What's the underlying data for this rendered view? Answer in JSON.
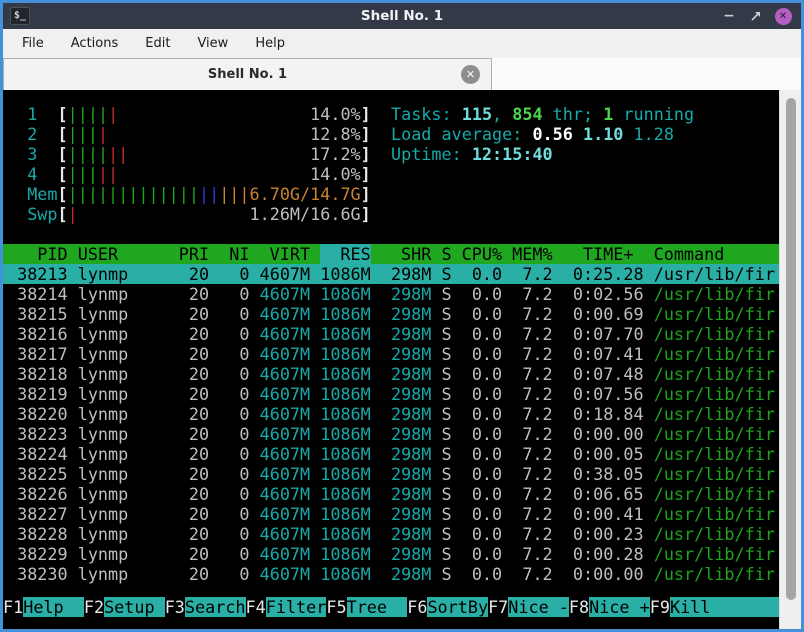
{
  "window": {
    "title": "Shell No. 1",
    "app_icon_glyph": "$_"
  },
  "titlebar_controls": {
    "minimize_glyph": "−",
    "close_glyph": "✕"
  },
  "menu": {
    "items": [
      "File",
      "Actions",
      "Edit",
      "View",
      "Help"
    ]
  },
  "tab": {
    "label": "Shell No. 1",
    "close_glyph": "✕"
  },
  "colors": {
    "frame_blue": "#4490DB",
    "titlebar_bg": "#333947",
    "close_button_purple": "#B55FC5",
    "header_green_bg": "#1FA81F",
    "selection_cyan_bg": "#29AFA5",
    "text_cyan": "#18A9A9",
    "text_bright_cyan": "#70DCDC",
    "text_green": "#1CA51C",
    "text_bright_green": "#4FD44F",
    "text_gray": "#BFBFBF",
    "bar_red": "#BE2D26",
    "bar_blue": "#3434D2",
    "bar_orange": "#C8832F"
  },
  "htop": {
    "meters": [
      {
        "label": "1",
        "bars": [
          {
            "color": "green",
            "text": "||||"
          },
          {
            "color": "red",
            "text": "|"
          }
        ],
        "value": "14.0%",
        "value_color": "gray"
      },
      {
        "label": "2",
        "bars": [
          {
            "color": "green",
            "text": "|||"
          },
          {
            "color": "red",
            "text": "|"
          }
        ],
        "value": "12.8%",
        "value_color": "gray"
      },
      {
        "label": "3",
        "bars": [
          {
            "color": "green",
            "text": "||||"
          },
          {
            "color": "red",
            "text": "||"
          }
        ],
        "value": "17.2%",
        "value_color": "gray"
      },
      {
        "label": "4",
        "bars": [
          {
            "color": "green",
            "text": "|||"
          },
          {
            "color": "red",
            "text": "||"
          }
        ],
        "value": "14.0%",
        "value_color": "gray"
      },
      {
        "label": "Mem",
        "bars": [
          {
            "color": "green",
            "text": "|||||||||||||"
          },
          {
            "color": "blue",
            "text": "||"
          },
          {
            "color": "orange",
            "text": "|||"
          }
        ],
        "value": "6.70G/14.7G",
        "value_color": "orange"
      },
      {
        "label": "Swp",
        "bars": [
          {
            "color": "red",
            "text": "|"
          }
        ],
        "value": "1.26M/16.6G",
        "value_color": "gray"
      }
    ],
    "stats": [
      [
        [
          "Tasks: ",
          "cyan"
        ],
        [
          "115",
          "bcyan"
        ],
        [
          ", ",
          "cyan"
        ],
        [
          "854",
          "bgreen"
        ],
        [
          " thr; ",
          "cyan"
        ],
        [
          "1",
          "bgreen"
        ],
        [
          " running",
          "cyan"
        ]
      ],
      [
        [
          "Load average: ",
          "cyan"
        ],
        [
          "0.56",
          "bwhite"
        ],
        [
          " ",
          "cyan"
        ],
        [
          "1.10",
          "bcyan"
        ],
        [
          " ",
          "cyan"
        ],
        [
          "1.28",
          "cyan"
        ]
      ],
      [
        [
          "Uptime: ",
          "cyan"
        ],
        [
          "12:15:40",
          "bcyan"
        ]
      ]
    ],
    "table": {
      "header_segments": [
        {
          "text": "   PID USER      PRI  NI  VIRT ",
          "selected": false
        },
        {
          "text": "  RES",
          "selected": true
        },
        {
          "text": "   SHR S CPU% MEM%   TIME+  Command",
          "selected": false
        }
      ],
      "selected_pid": "38213",
      "rows": [
        {
          "pid": "38213",
          "user": "lynmp",
          "pri": "20",
          "ni": "0",
          "virt": "4607M",
          "res": "1086M",
          "shr": "298M",
          "s": "S",
          "cpu": "0.0",
          "mem": "7.2",
          "time": "0:25.28",
          "cmd": "/usr/lib/fir"
        },
        {
          "pid": "38214",
          "user": "lynmp",
          "pri": "20",
          "ni": "0",
          "virt": "4607M",
          "res": "1086M",
          "shr": "298M",
          "s": "S",
          "cpu": "0.0",
          "mem": "7.2",
          "time": "0:02.56",
          "cmd": "/usr/lib/fir"
        },
        {
          "pid": "38215",
          "user": "lynmp",
          "pri": "20",
          "ni": "0",
          "virt": "4607M",
          "res": "1086M",
          "shr": "298M",
          "s": "S",
          "cpu": "0.0",
          "mem": "7.2",
          "time": "0:00.69",
          "cmd": "/usr/lib/fir"
        },
        {
          "pid": "38216",
          "user": "lynmp",
          "pri": "20",
          "ni": "0",
          "virt": "4607M",
          "res": "1086M",
          "shr": "298M",
          "s": "S",
          "cpu": "0.0",
          "mem": "7.2",
          "time": "0:07.70",
          "cmd": "/usr/lib/fir"
        },
        {
          "pid": "38217",
          "user": "lynmp",
          "pri": "20",
          "ni": "0",
          "virt": "4607M",
          "res": "1086M",
          "shr": "298M",
          "s": "S",
          "cpu": "0.0",
          "mem": "7.2",
          "time": "0:07.41",
          "cmd": "/usr/lib/fir"
        },
        {
          "pid": "38218",
          "user": "lynmp",
          "pri": "20",
          "ni": "0",
          "virt": "4607M",
          "res": "1086M",
          "shr": "298M",
          "s": "S",
          "cpu": "0.0",
          "mem": "7.2",
          "time": "0:07.48",
          "cmd": "/usr/lib/fir"
        },
        {
          "pid": "38219",
          "user": "lynmp",
          "pri": "20",
          "ni": "0",
          "virt": "4607M",
          "res": "1086M",
          "shr": "298M",
          "s": "S",
          "cpu": "0.0",
          "mem": "7.2",
          "time": "0:07.56",
          "cmd": "/usr/lib/fir"
        },
        {
          "pid": "38220",
          "user": "lynmp",
          "pri": "20",
          "ni": "0",
          "virt": "4607M",
          "res": "1086M",
          "shr": "298M",
          "s": "S",
          "cpu": "0.0",
          "mem": "7.2",
          "time": "0:18.84",
          "cmd": "/usr/lib/fir"
        },
        {
          "pid": "38223",
          "user": "lynmp",
          "pri": "20",
          "ni": "0",
          "virt": "4607M",
          "res": "1086M",
          "shr": "298M",
          "s": "S",
          "cpu": "0.0",
          "mem": "7.2",
          "time": "0:00.00",
          "cmd": "/usr/lib/fir"
        },
        {
          "pid": "38224",
          "user": "lynmp",
          "pri": "20",
          "ni": "0",
          "virt": "4607M",
          "res": "1086M",
          "shr": "298M",
          "s": "S",
          "cpu": "0.0",
          "mem": "7.2",
          "time": "0:00.05",
          "cmd": "/usr/lib/fir"
        },
        {
          "pid": "38225",
          "user": "lynmp",
          "pri": "20",
          "ni": "0",
          "virt": "4607M",
          "res": "1086M",
          "shr": "298M",
          "s": "S",
          "cpu": "0.0",
          "mem": "7.2",
          "time": "0:38.05",
          "cmd": "/usr/lib/fir"
        },
        {
          "pid": "38226",
          "user": "lynmp",
          "pri": "20",
          "ni": "0",
          "virt": "4607M",
          "res": "1086M",
          "shr": "298M",
          "s": "S",
          "cpu": "0.0",
          "mem": "7.2",
          "time": "0:06.65",
          "cmd": "/usr/lib/fir"
        },
        {
          "pid": "38227",
          "user": "lynmp",
          "pri": "20",
          "ni": "0",
          "virt": "4607M",
          "res": "1086M",
          "shr": "298M",
          "s": "S",
          "cpu": "0.0",
          "mem": "7.2",
          "time": "0:00.41",
          "cmd": "/usr/lib/fir"
        },
        {
          "pid": "38228",
          "user": "lynmp",
          "pri": "20",
          "ni": "0",
          "virt": "4607M",
          "res": "1086M",
          "shr": "298M",
          "s": "S",
          "cpu": "0.0",
          "mem": "7.2",
          "time": "0:00.23",
          "cmd": "/usr/lib/fir"
        },
        {
          "pid": "38229",
          "user": "lynmp",
          "pri": "20",
          "ni": "0",
          "virt": "4607M",
          "res": "1086M",
          "shr": "298M",
          "s": "S",
          "cpu": "0.0",
          "mem": "7.2",
          "time": "0:00.28",
          "cmd": "/usr/lib/fir"
        },
        {
          "pid": "38230",
          "user": "lynmp",
          "pri": "20",
          "ni": "0",
          "virt": "4607M",
          "res": "1086M",
          "shr": "298M",
          "s": "S",
          "cpu": "0.0",
          "mem": "7.2",
          "time": "0:00.00",
          "cmd": "/usr/lib/fir"
        }
      ]
    },
    "fnbar": [
      {
        "key": "F1",
        "label": "Help"
      },
      {
        "key": "F2",
        "label": "Setup"
      },
      {
        "key": "F3",
        "label": "Search"
      },
      {
        "key": "F4",
        "label": "Filter"
      },
      {
        "key": "F5",
        "label": "Tree"
      },
      {
        "key": "F6",
        "label": "SortBy"
      },
      {
        "key": "F7",
        "label": "Nice -"
      },
      {
        "key": "F8",
        "label": "Nice +"
      },
      {
        "key": "F9",
        "label": "Kill"
      }
    ]
  }
}
